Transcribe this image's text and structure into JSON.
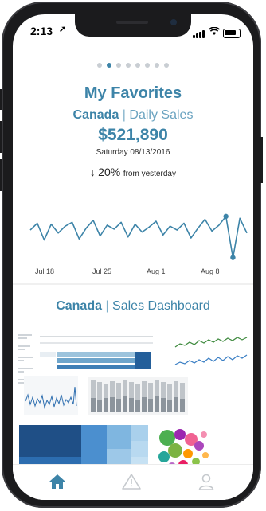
{
  "status_bar": {
    "time": "2:13",
    "location_icon": "location-arrow-icon"
  },
  "pager": {
    "count": 8,
    "active_index": 1
  },
  "favorites": {
    "title": "My Favorites",
    "region": "Canada",
    "separator": "|",
    "metric": "Daily Sales",
    "value": "$521,890",
    "date": "Saturday 08/13/2016",
    "change_arrow": "↓",
    "change_pct": "20%",
    "change_text": "from yesterday"
  },
  "chart_data": {
    "type": "line",
    "x_tick_labels": [
      "Jul 18",
      "Jul 25",
      "Aug 1",
      "Aug 8"
    ],
    "values": [
      58,
      65,
      48,
      64,
      55,
      62,
      66,
      49,
      60,
      68,
      52,
      63,
      59,
      66,
      51,
      64,
      56,
      61,
      67,
      53,
      62,
      58,
      65,
      50,
      60,
      69,
      57,
      63,
      72,
      30,
      70,
      55
    ],
    "highlight_indices": [
      28,
      29
    ],
    "ylim": [
      20,
      80
    ],
    "grid": false,
    "color": "#3d84a8"
  },
  "dashboard": {
    "region": "Canada",
    "separator": "|",
    "title": "Sales Dashboard"
  },
  "tab_bar": {
    "items": [
      {
        "name": "home",
        "icon": "home-icon",
        "active": true
      },
      {
        "name": "alerts",
        "icon": "alert-triangle-icon",
        "active": false
      },
      {
        "name": "profile",
        "icon": "person-icon",
        "active": false
      }
    ]
  },
  "colors": {
    "accent": "#3d84a8",
    "inactive_tab": "#c5c9cd",
    "dot_inactive": "#c9ced3"
  }
}
